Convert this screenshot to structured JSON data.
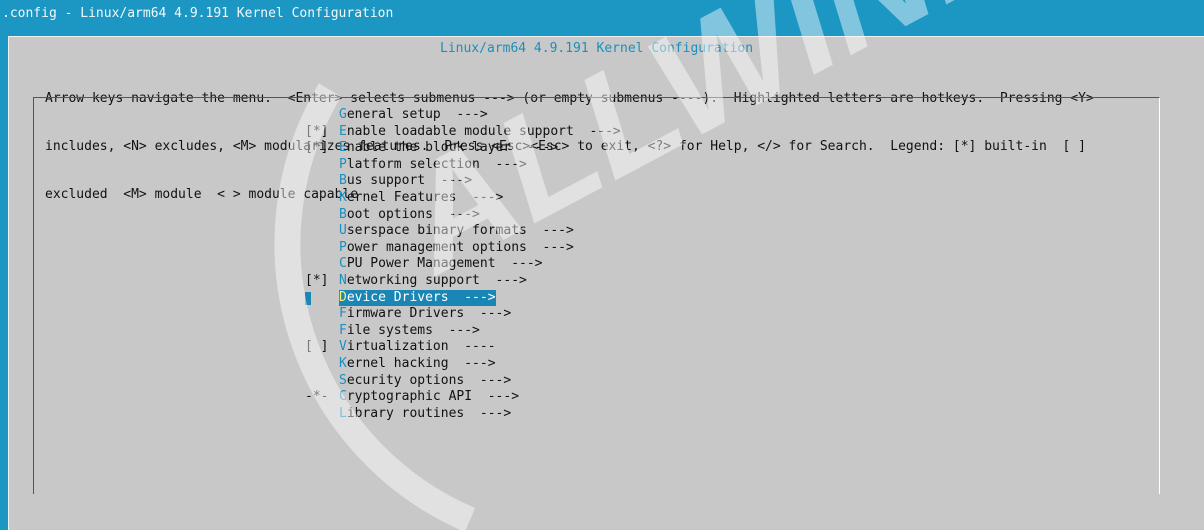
{
  "window": {
    "title": ".config - Linux/arm64 4.9.191 Kernel Configuration"
  },
  "dialog": {
    "title": "Linux/arm64 4.9.191 Kernel Configuration",
    "help_lines": [
      "Arrow keys navigate the menu.  <Enter> selects submenus ---> (or empty submenus ----).  Highlighted letters are hotkeys.  Pressing <Y>",
      "includes, <N> excludes, <M> modularizes features.  Press <Esc><Esc> to exit, <?> for Help, </> for Search.  Legend: [*] built-in  [ ]",
      "excluded  <M> module  < > module capable"
    ]
  },
  "menu": {
    "items": [
      {
        "prefix": "",
        "hotkey": "G",
        "rest": "eneral setup  --->"
      },
      {
        "prefix": "[*]",
        "hotkey": "E",
        "rest": "nable loadable module support  --->"
      },
      {
        "prefix": "[*]",
        "hotkey": "E",
        "rest": "nable the block layer  --->"
      },
      {
        "prefix": "",
        "hotkey": "P",
        "rest": "latform selection  --->"
      },
      {
        "prefix": "",
        "hotkey": "B",
        "rest": "us support  --->"
      },
      {
        "prefix": "",
        "hotkey": "K",
        "rest": "ernel Features  --->"
      },
      {
        "prefix": "",
        "hotkey": "B",
        "rest": "oot options  --->"
      },
      {
        "prefix": "",
        "hotkey": "U",
        "rest": "serspace binary formats  --->"
      },
      {
        "prefix": "",
        "hotkey": "P",
        "rest": "ower management options  --->"
      },
      {
        "prefix": "",
        "hotkey": "C",
        "rest": "PU Power Management  --->"
      },
      {
        "prefix": "[*]",
        "hotkey": "N",
        "rest": "etworking support  --->"
      },
      {
        "prefix": "",
        "hotkey": "D",
        "rest": "evice Drivers  --->",
        "selected": true
      },
      {
        "prefix": "",
        "hotkey": "F",
        "rest": "irmware Drivers  --->"
      },
      {
        "prefix": "",
        "hotkey": "F",
        "rest": "ile systems  --->"
      },
      {
        "prefix": "[ ]",
        "hotkey": "V",
        "rest": "irtualization  ----"
      },
      {
        "prefix": "",
        "hotkey": "K",
        "rest": "ernel hacking  --->"
      },
      {
        "prefix": "",
        "hotkey": "S",
        "rest": "ecurity options  --->"
      },
      {
        "prefix": "-*-",
        "hotkey": "C",
        "rest": "ryptographic API  --->"
      },
      {
        "prefix": "",
        "hotkey": "L",
        "rest": "ibrary routines  --->"
      }
    ]
  },
  "watermark": {
    "text": "ALLWINER"
  },
  "colors": {
    "background": "#1c96c3",
    "dialog": "#c8c8c8",
    "hotkey": "#1b8fc0",
    "selection": "#1a86b6",
    "selected_hotkey": "#f2f27a"
  }
}
